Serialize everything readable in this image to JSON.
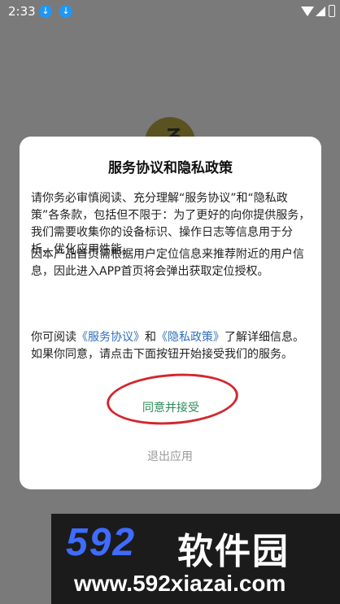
{
  "status_bar": {
    "time": "2:33",
    "icons": [
      "download-icon",
      "download-icon",
      "wifi-icon",
      "signal-icon",
      "battery-icon"
    ]
  },
  "app_logo": {
    "glyph": "ろ"
  },
  "dialog": {
    "title": "服务协议和隐私政策",
    "paragraph1": "请你务必审慎阅读、充分理解“服务协议”和“隐私政策”各条款，包括但不限于：为了更好的向你提供服务，我们需要收集你的设备标识、操作日志等信息用于分析、优化应用性能。",
    "paragraph2": "因本产品首页需根据用户定位信息来推荐附近的用户信息，因此进入APP首页将会弹出获取定位授权。",
    "paragraph3_prefix": "你可阅读",
    "service_link": "《服务协议》",
    "paragraph3_and": "和",
    "privacy_link": "《隐私政策》",
    "paragraph3_suffix": "了解详细信息。如果你同意，请点击下面按钮开始接受我们的服务。",
    "agree_label": "同意并接受",
    "exit_label": "退出应用"
  },
  "watermark": {
    "number": "592",
    "brand": "软件园",
    "url": "www.592xiazai.com"
  },
  "colors": {
    "link": "#2f6fbd",
    "agree": "#2e8b57",
    "annotation_ellipse": "#d1282e",
    "watermark_number": "#3f6cff"
  }
}
